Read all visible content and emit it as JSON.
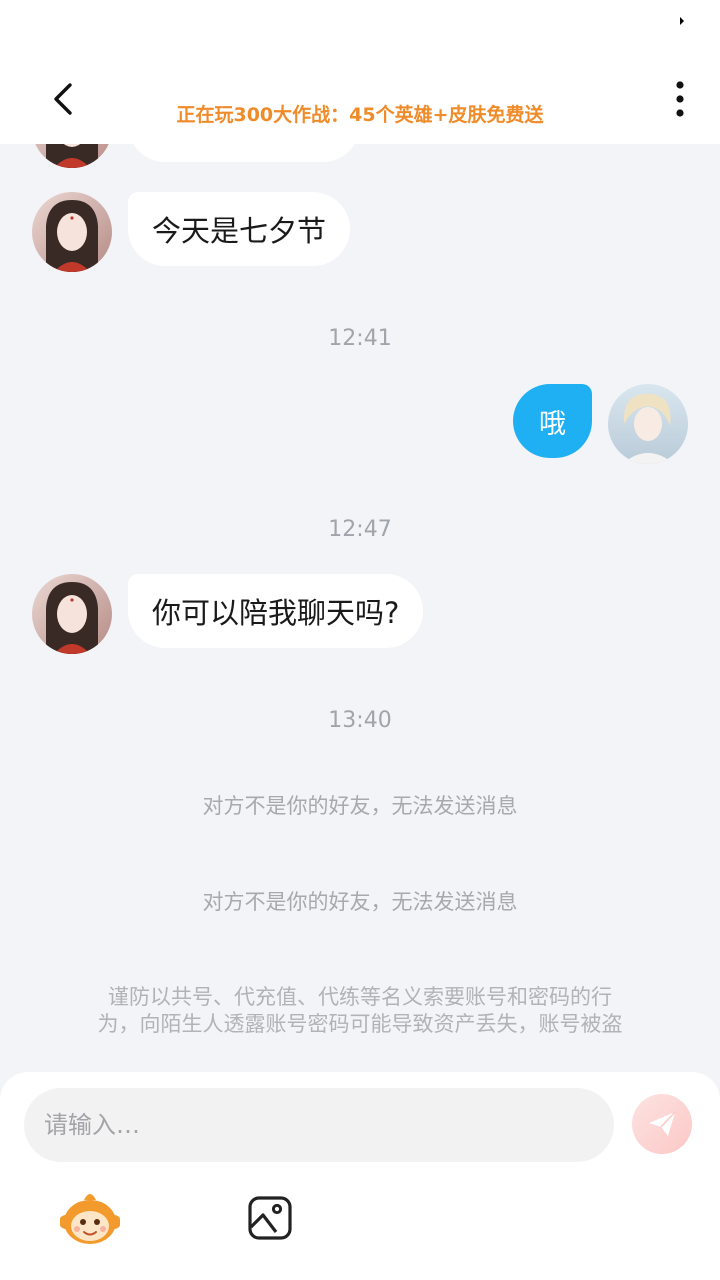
{
  "header": {
    "playing_banner": "正在玩300大作战：45个英雄+皮肤免费送"
  },
  "messages": {
    "in_1": "今天是七夕节",
    "time_1": "12:41",
    "out_1": "哦",
    "time_2": "12:47",
    "in_2": "你可以陪我聊天吗?",
    "time_3": "13:40",
    "system_1": "对方不是你的好友，无法发送消息",
    "system_2": "对方不是你的好友，无法发送消息",
    "warning_line1": "谨防以共号、代充值、代练等名义索要账号和密码的行",
    "warning_line2": "为，向陌生人透露账号密码可能导致资产丢失，账号被盗"
  },
  "composer": {
    "placeholder": "请输入…"
  },
  "icons": {
    "back": "back-arrow-icon",
    "more": "more-vertical-icon",
    "send": "paper-plane-icon",
    "emoji": "monkey-emoji-icon",
    "image": "image-icon"
  },
  "colors": {
    "banner": "#f08b2a",
    "outgoing_bubble": "#1fb0f4",
    "background": "#f2f4f7"
  }
}
